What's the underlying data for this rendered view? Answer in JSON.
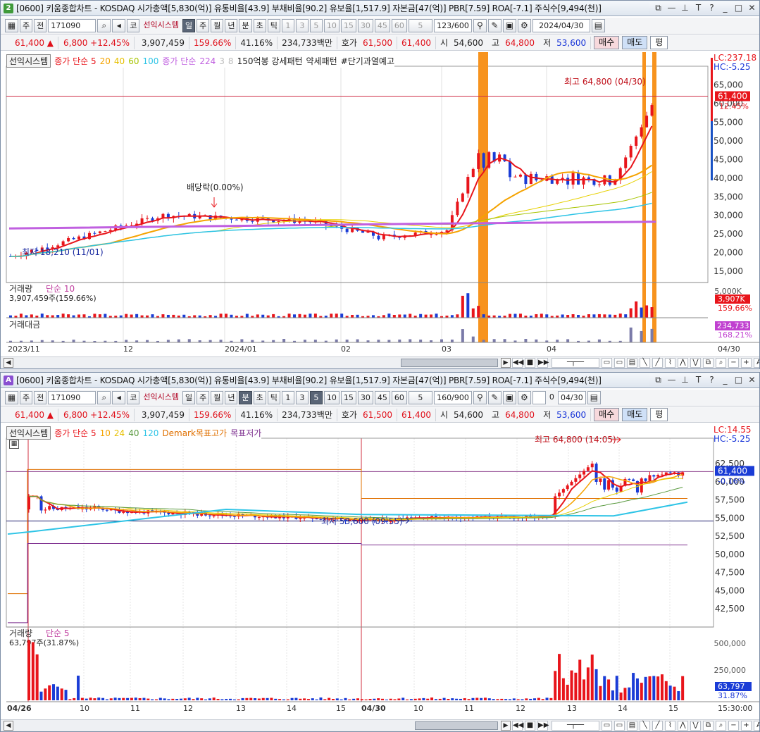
{
  "win1": {
    "badge": "2",
    "title": "[0600] 키움종합차트 - KOSDAQ 시가총액[5,830(억)] 유통비율[43.9] 부채비율[90.2] 유보율[1,517.9] 자본금[47(억)] PBR[7.59] ROA[-7.1] 주식수[9,494(천)]",
    "toolbar": {
      "mode1": "주",
      "mode2": "전",
      "code": "171090",
      "kr": "코",
      "sys": "선익시스템",
      "periods": [
        "일",
        "주",
        "월",
        "년",
        "분",
        "초",
        "틱"
      ],
      "active": "일",
      "nums": [
        "1",
        "3",
        "5",
        "10",
        "15",
        "30",
        "45",
        "60"
      ],
      "sel": "5",
      "count": "123/600",
      "date": "2024/04/30"
    },
    "quote": {
      "price": "61,400 ▲",
      "change": "6,800 +12.45%",
      "volume": "3,907,459",
      "vol_ratio": "159.66%",
      "turnover": "41.16%",
      "amount": "234,733백만",
      "hoga_lbl": "호가",
      "hoga1": "61,500",
      "hoga2": "61,400",
      "open_lbl": "시",
      "open": "54,600",
      "high_lbl": "고",
      "high": "64,800",
      "low_lbl": "저",
      "low": "53,600",
      "buy": "매수",
      "sell": "매도",
      "eval": "평"
    },
    "legend": {
      "sys": "선익시스템",
      "ma": "종가 단순 5",
      "ma_p": [
        "20",
        "40",
        "60",
        "100"
      ],
      "ma2": "종가 단순",
      "ma2_p": [
        "224",
        "3",
        "8"
      ],
      "pat1": "150억봉 강세패턴",
      "pat2": "약세패턴",
      "pat3": "#단기과열예고"
    },
    "price_axis": [
      "65,000",
      "60,000",
      "55,000",
      "50,000",
      "45,000",
      "40,000",
      "35,000",
      "30,000",
      "25,000",
      "20,000",
      "15,000"
    ],
    "lc": "LC:237.18",
    "hc": "HC:-5.25",
    "last": "61,400",
    "last_pct": "12.45%",
    "high_note": "최고 64,800 (04/30)",
    "low_note": "최저 18,210 (11/01)",
    "div_note": "배당락(0.00%)",
    "vol": {
      "title": "거래량",
      "ma": "단순 10",
      "value": "3,907,459주(159.66%)",
      "axis": "5,000K",
      "last": "3,907K",
      "pct": "159.66%"
    },
    "amt": {
      "title": "거래대금",
      "last": "234,733",
      "pct": "168.21%"
    },
    "xaxis": [
      "2023/11",
      "12",
      "2024/01",
      "02",
      "03",
      "04",
      "04/30"
    ]
  },
  "win2": {
    "badge": "A",
    "title": "[0600] 키움종합차트 - KOSDAQ 시가총액[5,830(억)] 유통비율[43.9] 부채비율[90.2] 유보율[1,517.9] 자본금[47(억)] PBR[7.59] ROA[-7.1] 주식수[9,494(천)]",
    "toolbar": {
      "mode1": "주",
      "mode2": "전",
      "code": "171090",
      "kr": "코",
      "sys": "선익시스템",
      "periods": [
        "일",
        "주",
        "월",
        "년",
        "분",
        "초",
        "틱"
      ],
      "active": "분",
      "nums": [
        "1",
        "3",
        "5",
        "10",
        "15",
        "30",
        "45",
        "60"
      ],
      "sel": "5",
      "count": "160/900",
      "date": "04/30",
      "chk": "0"
    },
    "quote": {
      "price": "61,400 ▲",
      "change": "6,800 +12.45%",
      "volume": "3,907,459",
      "vol_ratio": "159.66%",
      "turnover": "41.16%",
      "amount": "234,733백만",
      "hoga_lbl": "호가",
      "hoga1": "61,500",
      "hoga2": "61,400",
      "open_lbl": "시",
      "open": "54,600",
      "high_lbl": "고",
      "high": "64,800",
      "low_lbl": "저",
      "low": "53,600",
      "buy": "매수",
      "sell": "매도",
      "eval": "평"
    },
    "legend": {
      "sys": "선익시스템",
      "ma": "종가 단순 5",
      "ma_p": [
        "10",
        "24",
        "40",
        "120"
      ],
      "demark": "Demark목표고가",
      "target_low": "목표저가"
    },
    "price_axis": [
      "62,500",
      "60,000",
      "57,500",
      "55,000",
      "52,500",
      "50,000",
      "47,500",
      "45,000",
      "42,500"
    ],
    "lc": "LC:14.55",
    "hc": "HC:-5.25",
    "last": "61,400",
    "last_pct": "-0.16%",
    "high_note": "최고 64,800 (14:05)",
    "low_note": "최저 53,600 (09:55)",
    "vol": {
      "title": "거래량",
      "ma": "단순 5",
      "value": "63,797주(31.87%)",
      "axis": [
        "500,000",
        "250,000"
      ],
      "last": "63,797",
      "pct": "31.87%"
    },
    "xaxis": [
      "04/26",
      "10",
      "11",
      "12",
      "13",
      "14",
      "15",
      "04/30",
      "10",
      "11",
      "12",
      "13",
      "14",
      "15",
      "15:30:00"
    ]
  },
  "colors": {
    "up": "#e8151b",
    "down": "#1a3cd6",
    "highlight": "#f7931e",
    "ma5": "#e8151b",
    "ma20": "#f5a300",
    "ma40": "#e7d000",
    "ma60": "#a7c400",
    "ma100": "#2ec4e6",
    "ma224": "#c060e0",
    "purple": "#7a2a8c"
  }
}
